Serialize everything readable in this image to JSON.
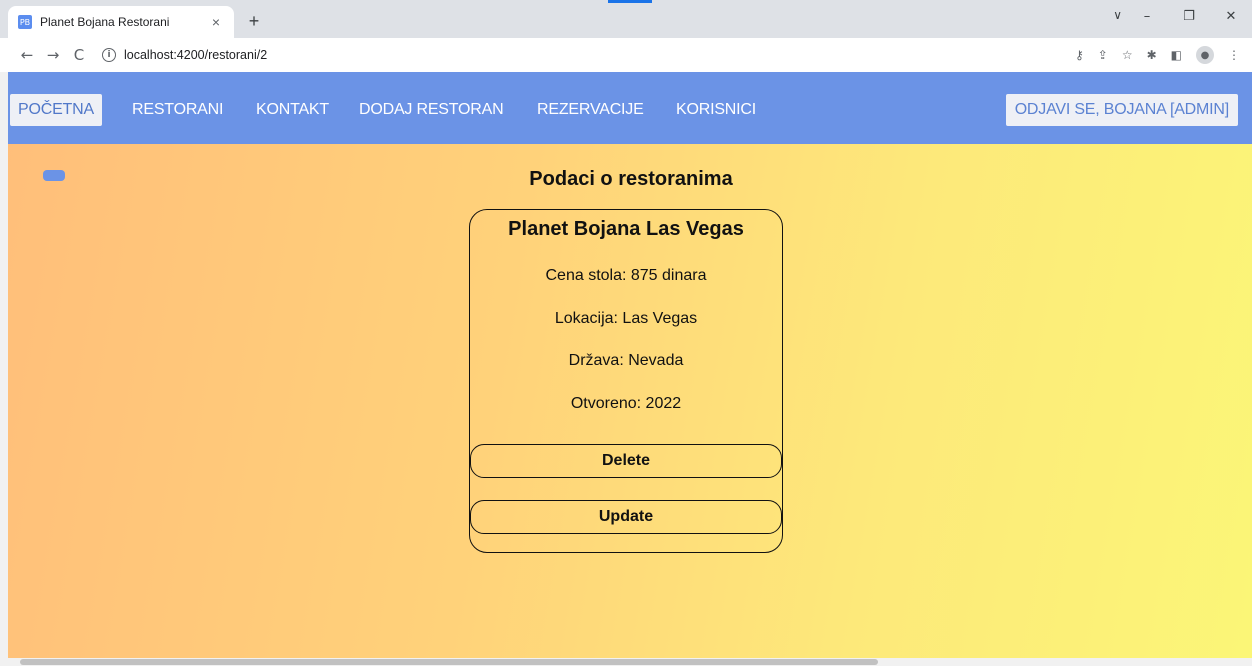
{
  "browser": {
    "tab_title": "Planet Bojana Restorani",
    "favicon_text": "PB",
    "tab_close": "×",
    "new_tab": "+",
    "url": "localhost:4200/restorani/2",
    "back": "←",
    "forward": "→",
    "reload": "C",
    "info": "i",
    "tab_search": "∨",
    "minimize": "–",
    "restore": "❐",
    "close": "✕",
    "icons": [
      "key-icon",
      "share-icon",
      "star-icon",
      "extensions-icon",
      "sidepanel-icon",
      "profile-icon",
      "menu-icon"
    ]
  },
  "nav": {
    "items": [
      {
        "label": "POČETNA",
        "active": true
      },
      {
        "label": "RESTORANI",
        "active": false
      },
      {
        "label": "KONTAKT",
        "active": false
      },
      {
        "label": "DODAJ RESTORAN",
        "active": false
      },
      {
        "label": "REZERVACIJE",
        "active": false
      },
      {
        "label": "KORISNICI",
        "active": false
      }
    ],
    "logout": "ODJAVI SE, BOJANA [ADMIN]",
    "accent": "#6b93e6"
  },
  "page": {
    "heading": "Podaci o restoranima"
  },
  "restaurant": {
    "name": "Planet Bojana Las Vegas",
    "price": "Cena stola: 875 dinara",
    "location": "Lokacija: Las Vegas",
    "country": "Država: Nevada",
    "opened": "Otvoreno: 2022",
    "delete_label": "Delete",
    "update_label": "Update"
  }
}
